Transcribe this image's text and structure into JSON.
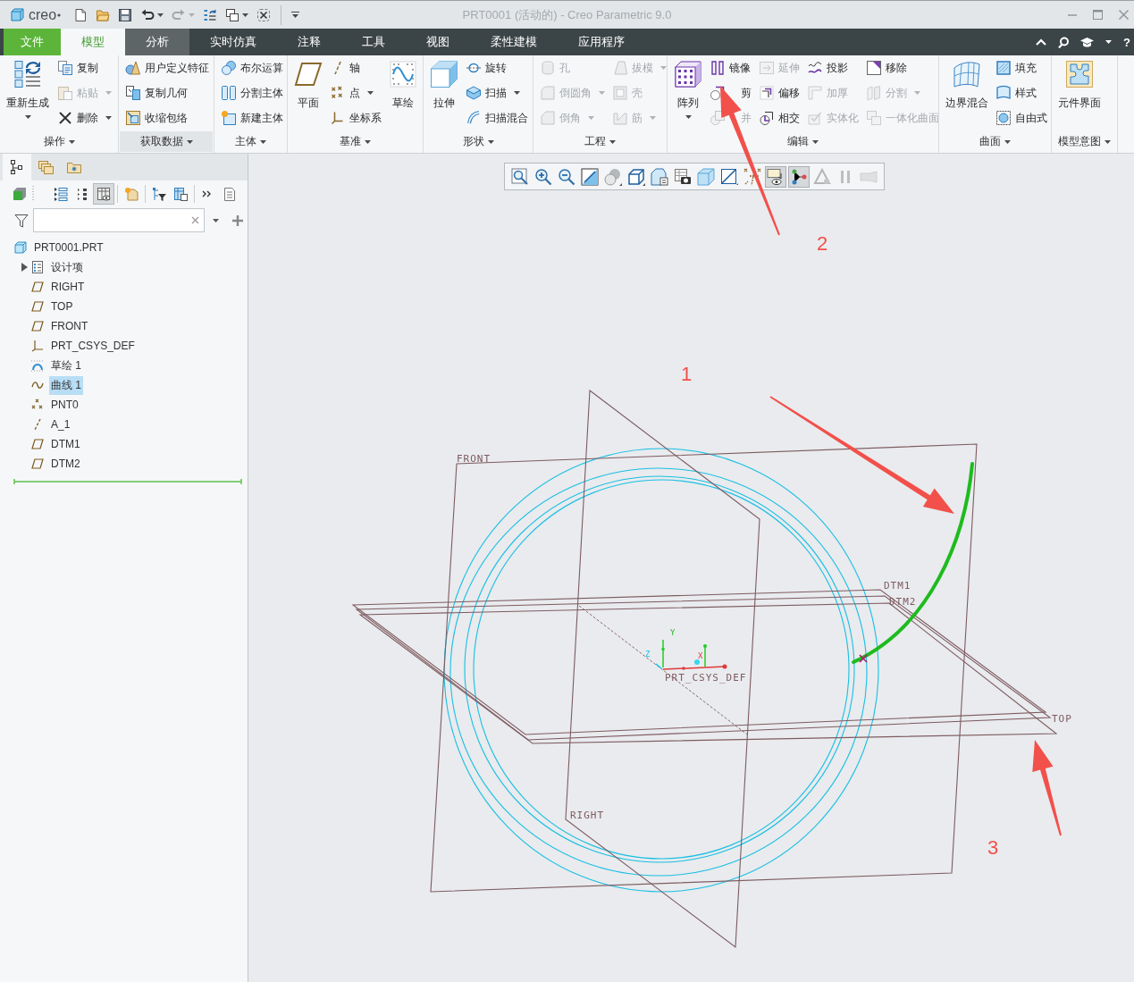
{
  "window": {
    "logo": "creo",
    "title": "PRT0001 (活动的) - Creo Parametric 9.0"
  },
  "quick_access": [
    {
      "menu": false,
      "disabled": false
    },
    {
      "menu": false,
      "disabled": false
    },
    {
      "menu": false,
      "disabled": false
    },
    {
      "menu": true,
      "disabled": false
    },
    {
      "menu": true,
      "disabled": true
    },
    {
      "menu": false,
      "disabled": false
    },
    {
      "menu": true,
      "disabled": false
    },
    {
      "menu": false,
      "disabled": false
    }
  ],
  "tabs": [
    {
      "label": "文件",
      "kind": "file",
      "selected": false,
      "highlighted": false
    },
    {
      "label": "模型",
      "kind": "tab",
      "selected": true,
      "highlighted": false
    },
    {
      "label": "分析",
      "kind": "tab",
      "selected": false,
      "highlighted": true
    },
    {
      "label": "实时仿真",
      "kind": "tab",
      "selected": false,
      "highlighted": false
    },
    {
      "label": "注释",
      "kind": "tab",
      "selected": false,
      "highlighted": false
    },
    {
      "label": "工具",
      "kind": "tab",
      "selected": false,
      "highlighted": false
    },
    {
      "label": "视图",
      "kind": "tab",
      "selected": false,
      "highlighted": false
    },
    {
      "label": "柔性建模",
      "kind": "tab",
      "selected": false,
      "highlighted": false
    },
    {
      "label": "应用程序",
      "kind": "tab",
      "selected": false,
      "highlighted": false
    }
  ],
  "help": "?",
  "ribbon": [
    {
      "label": "操作",
      "menu": true,
      "highlighted": false,
      "columns": [
        {
          "kind": "large",
          "label": "重新生成",
          "menu": true,
          "disabled": false
        },
        {
          "kind": "stack",
          "items": [
            {
              "label": "复制",
              "menu": false,
              "disabled": false
            },
            {
              "label": "粘贴",
              "menu": true,
              "disabled": true
            },
            {
              "label": "删除",
              "menu": true,
              "disabled": false
            }
          ]
        }
      ]
    },
    {
      "label": "获取数据",
      "menu": true,
      "highlighted": true,
      "columns": [
        {
          "kind": "stack",
          "items": [
            {
              "label": "用户定义特征",
              "menu": false,
              "disabled": false
            },
            {
              "label": "复制几何",
              "menu": false,
              "disabled": false
            },
            {
              "label": "收缩包络",
              "menu": false,
              "disabled": false
            }
          ]
        }
      ]
    },
    {
      "label": "主体",
      "menu": true,
      "highlighted": false,
      "columns": [
        {
          "kind": "stack",
          "items": [
            {
              "label": "布尔运算",
              "menu": false,
              "disabled": false
            },
            {
              "label": "分割主体",
              "menu": false,
              "disabled": false
            },
            {
              "label": "新建主体",
              "menu": false,
              "disabled": false
            }
          ]
        }
      ]
    },
    {
      "label": "基准",
      "menu": true,
      "highlighted": false,
      "columns": [
        {
          "kind": "large",
          "label": "平面",
          "menu": false,
          "disabled": false
        },
        {
          "kind": "stack",
          "items": [
            {
              "label": "轴",
              "menu": false,
              "disabled": false
            },
            {
              "label": "点",
              "menu": true,
              "disabled": false
            },
            {
              "label": "坐标系",
              "menu": false,
              "disabled": false
            }
          ]
        },
        {
          "kind": "large",
          "label": "草绘",
          "menu": false,
          "disabled": false
        }
      ]
    },
    {
      "label": "形状",
      "menu": true,
      "highlighted": false,
      "columns": [
        {
          "kind": "large",
          "label": "拉伸",
          "menu": false,
          "disabled": false
        },
        {
          "kind": "stack",
          "items": [
            {
              "label": "旋转",
              "menu": false,
              "disabled": false
            },
            {
              "label": "扫描",
              "menu": true,
              "disabled": false
            },
            {
              "label": "扫描混合",
              "menu": false,
              "disabled": false
            }
          ]
        }
      ]
    },
    {
      "label": "工程",
      "menu": true,
      "highlighted": false,
      "columns": [
        {
          "kind": "stack",
          "items": [
            {
              "label": "孔",
              "menu": false,
              "disabled": true
            },
            {
              "label": "倒圆角",
              "menu": true,
              "disabled": true
            },
            {
              "label": "倒角",
              "menu": true,
              "disabled": true
            }
          ]
        },
        {
          "kind": "stack",
          "items": [
            {
              "label": "拔模",
              "menu": true,
              "disabled": true
            },
            {
              "label": "壳",
              "menu": false,
              "disabled": true
            },
            {
              "label": "筋",
              "menu": true,
              "disabled": true
            }
          ]
        }
      ]
    },
    {
      "label": "编辑",
      "menu": true,
      "highlighted": false,
      "columns": [
        {
          "kind": "large",
          "label": "阵列",
          "menu": true,
          "disabled": false
        },
        {
          "kind": "stack",
          "items": [
            {
              "label": "镜像",
              "menu": false,
              "disabled": false
            },
            {
              "label": "剪",
              "menu": false,
              "disabled": false
            },
            {
              "label": "并",
              "menu": false,
              "disabled": true
            }
          ]
        },
        {
          "kind": "stack",
          "items": [
            {
              "label": "延伸",
              "menu": false,
              "disabled": true
            },
            {
              "label": "偏移",
              "menu": false,
              "disabled": false
            },
            {
              "label": "相交",
              "menu": false,
              "disabled": false
            }
          ]
        },
        {
          "kind": "stack",
          "items": [
            {
              "label": "投影",
              "menu": false,
              "disabled": false
            },
            {
              "label": "加厚",
              "menu": false,
              "disabled": true
            },
            {
              "label": "实体化",
              "menu": false,
              "disabled": true
            }
          ]
        },
        {
          "kind": "stack",
          "items": [
            {
              "label": "移除",
              "menu": false,
              "disabled": false
            },
            {
              "label": "分割",
              "menu": true,
              "disabled": true
            },
            {
              "label": "一体化曲面",
              "menu": false,
              "disabled": true
            }
          ]
        }
      ]
    },
    {
      "label": "曲面",
      "menu": true,
      "highlighted": false,
      "columns": [
        {
          "kind": "large",
          "label": "边界混合",
          "menu": false,
          "disabled": false
        },
        {
          "kind": "stack",
          "items": [
            {
              "label": "填充",
              "menu": false,
              "disabled": false
            },
            {
              "label": "样式",
              "menu": false,
              "disabled": false
            },
            {
              "label": "自由式",
              "menu": false,
              "disabled": false
            }
          ]
        }
      ]
    },
    {
      "label": "模型意图",
      "menu": true,
      "highlighted": false,
      "columns": [
        {
          "kind": "large",
          "label": "元件界面",
          "menu": false,
          "disabled": false
        }
      ]
    }
  ],
  "panel": {
    "tabs": [
      {
        "selected": true
      },
      {
        "selected": false
      },
      {
        "selected": false
      }
    ],
    "toolbar": [
      {
        "pressed": false
      },
      {
        "pressed": false
      },
      {
        "pressed": false
      },
      {
        "pressed": true
      },
      {
        "pressed": false
      },
      {
        "pressed": false
      },
      {
        "pressed": false
      },
      {
        "pressed": false
      },
      {
        "pressed": false
      }
    ],
    "tree": {
      "label": "PRT0001.PRT",
      "kind": "part",
      "selected": false,
      "children": [
        {
          "label": "设计项",
          "kind": "folder",
          "expanded": false,
          "selected": false
        },
        {
          "label": "RIGHT",
          "kind": "plane",
          "selected": false
        },
        {
          "label": "TOP",
          "kind": "plane",
          "selected": false
        },
        {
          "label": "FRONT",
          "kind": "plane",
          "selected": false
        },
        {
          "label": "PRT_CSYS_DEF",
          "kind": "csys",
          "selected": false
        },
        {
          "label": "草绘 1",
          "kind": "sketch",
          "selected": false
        },
        {
          "label": "曲线 1",
          "kind": "curve",
          "selected": true
        },
        {
          "label": "PNT0",
          "kind": "point",
          "selected": false
        },
        {
          "label": "A_1",
          "kind": "axis",
          "selected": false
        },
        {
          "label": "DTM1",
          "kind": "plane",
          "selected": false
        },
        {
          "label": "DTM2",
          "kind": "plane",
          "selected": false
        }
      ]
    }
  },
  "view_toolbar": [
    {
      "pressed": false,
      "disabled": false
    },
    {
      "pressed": false,
      "disabled": false
    },
    {
      "pressed": false,
      "disabled": false
    },
    {
      "pressed": false,
      "disabled": false
    },
    {
      "pressed": false,
      "disabled": false
    },
    {
      "pressed": false,
      "disabled": false
    },
    {
      "pressed": false,
      "disabled": false
    },
    {
      "pressed": false,
      "disabled": false
    },
    {
      "pressed": false,
      "disabled": false
    },
    {
      "pressed": false,
      "disabled": false
    },
    {
      "pressed": false,
      "disabled": false
    },
    {
      "pressed": true,
      "disabled": false
    },
    {
      "pressed": true,
      "disabled": false
    },
    {
      "pressed": false,
      "disabled": true
    },
    {
      "pressed": false,
      "disabled": true
    },
    {
      "pressed": false,
      "disabled": true
    }
  ],
  "model": {
    "planes": [
      "FRONT",
      "RIGHT",
      "DTM1",
      "DTM2",
      "TOP"
    ],
    "csys": {
      "label": "PRT_CSYS_DEF",
      "axes": [
        "X",
        "Y",
        "Z"
      ]
    }
  },
  "annotations": [
    "1",
    "2",
    "3"
  ]
}
